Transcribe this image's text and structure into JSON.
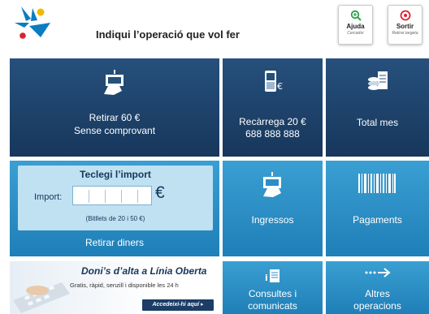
{
  "header": {
    "title": "Indiqui l’operació que vol fer",
    "help": {
      "label": "Ajuda",
      "sub": "Cercador"
    },
    "exit": {
      "label": "Sortir",
      "sub": "Retirar targeta"
    }
  },
  "tiles": {
    "retirar_60": {
      "line1": "Retirar 60 €",
      "line2": "Sense comprovant"
    },
    "recarrega": {
      "line1": "Recàrrega 20 €",
      "line2": "688 888 888"
    },
    "total_mes": {
      "label": "Total mes"
    },
    "teclegi": {
      "title": "Teclegi l’import",
      "import_label": "Import:",
      "euro_symbol": "€",
      "hint": "(Bitllets de 20 i 50 €)",
      "action": "Retirar diners"
    },
    "ingressos": {
      "label": "Ingressos"
    },
    "pagaments": {
      "label": "Pagaments"
    },
    "consultes": {
      "line1": "Consultes i",
      "line2": "comunicats"
    },
    "altres": {
      "line1": "Altres",
      "line2": "operacions"
    }
  },
  "banner": {
    "title": "Doni’s d’alta a Línia Oberta",
    "subtitle": "Gratis, ràpid, senzill i disponible les 24 h",
    "button": "Accedeixi-hi aquí ▸"
  },
  "colors": {
    "dark_tile": "#1d426a",
    "light_tile": "#2b8ec6",
    "brand_blue": "#0b7cc1",
    "brand_red": "#d9232e"
  },
  "icons": [
    "caixa-star-logo",
    "search-icon",
    "exit-icon",
    "cash-withdraw-icon",
    "mobile-recharge-icon",
    "coins-report-icon",
    "deposit-icon",
    "barcode-icon",
    "document-query-icon",
    "more-arrow-icon"
  ]
}
